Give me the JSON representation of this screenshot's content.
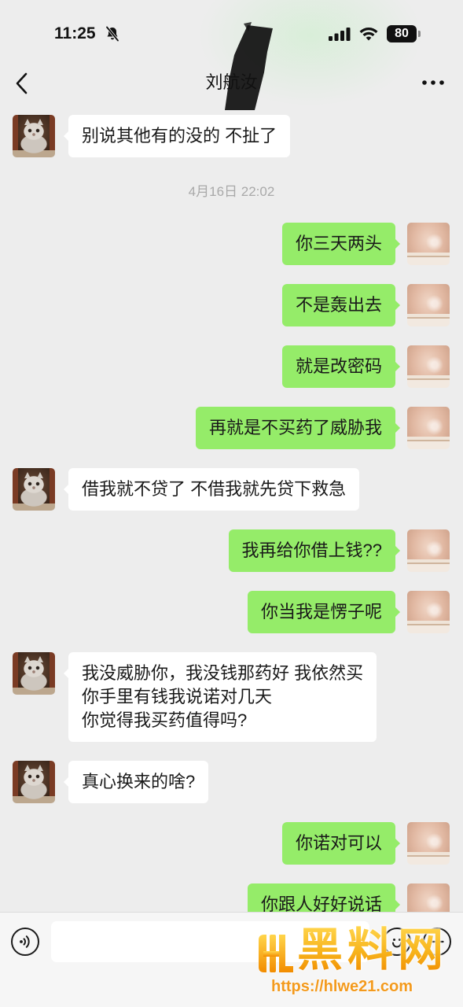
{
  "status_bar": {
    "time": "11:25",
    "battery_level": "80",
    "icons": [
      "bell-slash-icon",
      "signal-icon",
      "wifi-icon",
      "battery-icon"
    ]
  },
  "nav": {
    "title": "刘航汝",
    "back_icon": "chevron-left-icon",
    "more_icon": "more-icon"
  },
  "chat": {
    "items": [
      {
        "text": "别说其他有的没的 不扯了",
        "outgoing": false
      },
      {
        "timestamp": "4月16日 22:02"
      },
      {
        "text": "你三天两头",
        "outgoing": true
      },
      {
        "text": "不是轰出去",
        "outgoing": true
      },
      {
        "text": "就是改密码",
        "outgoing": true
      },
      {
        "text": "再就是不买药了威胁我",
        "outgoing": true
      },
      {
        "text": "借我就不贷了 不借我就先贷下救急",
        "outgoing": false
      },
      {
        "text": "我再给你借上钱??",
        "outgoing": true
      },
      {
        "text": "你当我是愣子呢",
        "outgoing": true
      },
      {
        "text": "我没威胁你，我没钱那药好 我依然买\n你手里有钱我说诺对几天\n你觉得我买药值得吗?",
        "outgoing": false
      },
      {
        "text": "真心换来的啥?",
        "outgoing": false
      },
      {
        "text": "你诺对可以",
        "outgoing": true
      },
      {
        "text": "你跟人好好说话",
        "outgoing": true
      }
    ]
  },
  "input_bar": {
    "value": "",
    "icons": [
      "voice-icon",
      "emoji-icon",
      "plus-icon"
    ]
  },
  "watermark": {
    "brand": "黑料网",
    "url": "https://hlwe21.com"
  },
  "colors": {
    "background": "#ededed",
    "outgoing_bubble": "#95ec69",
    "incoming_bubble": "#ffffff",
    "timestamp_text": "#a9a9a9",
    "watermark_gold": "#f7b21a",
    "watermark_url": "#f39a1d"
  }
}
